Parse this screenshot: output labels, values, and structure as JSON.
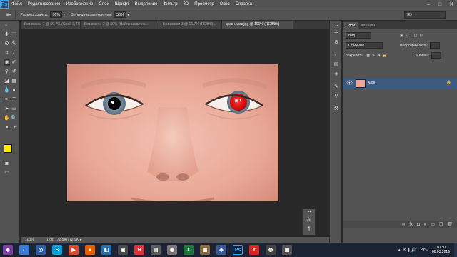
{
  "app": {
    "logo": "Ps"
  },
  "menu": [
    "Файл",
    "Редактирование",
    "Изображение",
    "Слои",
    "Шрифт",
    "Выделение",
    "Фильтр",
    "3D",
    "Просмотр",
    "Окно",
    "Справка"
  ],
  "options": {
    "pupil_size_label": "Размер зрачка:",
    "pupil_size_value": "50%",
    "darken_label": "Величина затемнения:",
    "darken_value": "50%",
    "workspace": "3D"
  },
  "tabs": [
    {
      "label": "Без имени-1 @ 66,7% (Слой 3, RGB/8)...",
      "active": false
    },
    {
      "label": "Без имени-2 @ 50% (Найти заказчик...",
      "active": false
    },
    {
      "label": "Без имени-3 @ 16,7% (RGB/8)...",
      "active": false
    },
    {
      "label": "красн.глаз.jpg @ 100% (RGB/8#)",
      "active": true
    }
  ],
  "status": {
    "zoom": "100%",
    "doc": "Док: 772,9K/772,9K"
  },
  "layers_panel": {
    "tab_layers": "Слои",
    "tab_channels": "Каналы",
    "kind": "Вид",
    "blend_mode": "Обычные",
    "opacity_label": "Непрозрачность:",
    "lock_label": "Закрепить:",
    "fill_label": "Заливка:",
    "layer_name": "Фон"
  },
  "taskbar": {
    "lang": "РУС",
    "time": "10:30",
    "date": "08.03.2019"
  },
  "colors": {
    "foreground": "#ffea00",
    "background": "#1a1aff",
    "accent": "#31a8ff"
  }
}
